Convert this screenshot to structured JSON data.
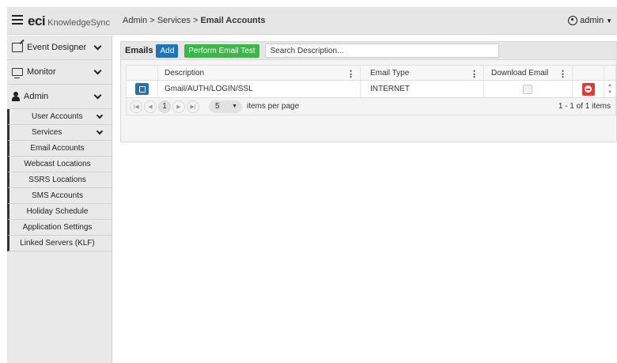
{
  "header": {
    "logo_main": "eci",
    "logo_product": "KnowledgeSync",
    "breadcrumb_prefix": "Admin > Services > ",
    "breadcrumb_current": "Email Accounts",
    "user": "admin"
  },
  "sidebar": {
    "top_items": [
      {
        "label": "Event Designer",
        "icon": "edit-icon"
      },
      {
        "label": "Monitor",
        "icon": "monitor-icon"
      },
      {
        "label": "Admin",
        "icon": "person-icon"
      }
    ],
    "sub_items": {
      "user_accounts": "User Accounts",
      "services": "Services",
      "email_accounts": "Email Accounts",
      "webcast_locations": "Webcast Locations",
      "ssrs_locations": "SSRS Locations",
      "sms_accounts": "SMS Accounts",
      "holiday_schedule": "Holiday Schedule",
      "application_settings": "Application Settings",
      "linked_servers": "Linked Servers (KLF)"
    }
  },
  "toolbar": {
    "label": "Emails",
    "add_label": "Add",
    "test_label": "Perform Email Test",
    "search_placeholder": "Search Description..."
  },
  "grid": {
    "columns": [
      "Description",
      "Email Type",
      "Download Email"
    ],
    "rows": [
      {
        "description": "Gmail/AUTH/LOGIN/SSL",
        "email_type": "INTERNET",
        "download_email": false
      }
    ]
  },
  "pager": {
    "current_page": "1",
    "page_size": "5",
    "items_per_page_label": "items per page",
    "info": "1 - 1 of 1 items"
  },
  "colors": {
    "primary": "#1f73b7",
    "success": "#3cb54a",
    "danger": "#e53935"
  }
}
